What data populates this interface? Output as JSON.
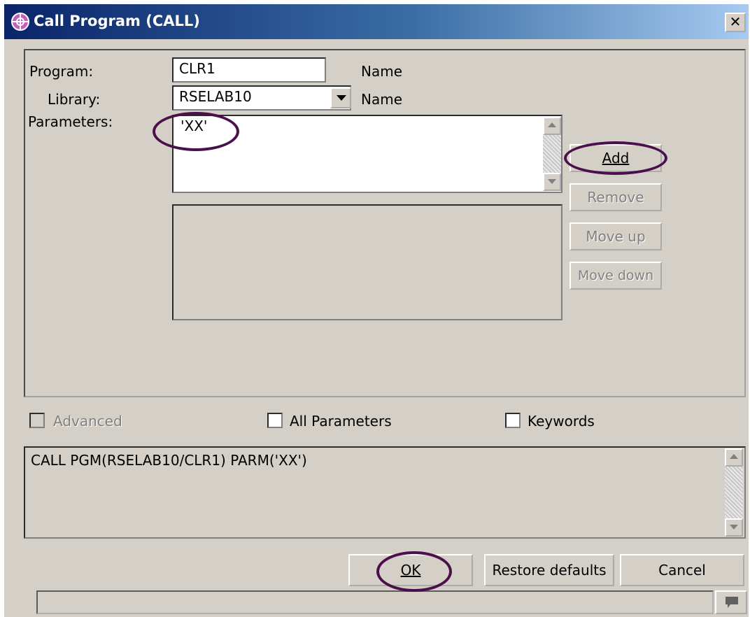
{
  "window": {
    "title": "Call Program (CALL)",
    "close_glyph": "✕"
  },
  "form": {
    "program_label": "Program:",
    "program_value": "CLR1",
    "program_hint": "Name",
    "library_label": "Library:",
    "library_value": "RSELAB10",
    "library_hint": "Name",
    "parameters_label": "Parameters:",
    "parameters_value": "'XX'"
  },
  "buttons": {
    "add": "Add",
    "remove": "Remove",
    "move_up": "Move up",
    "move_down": "Move down",
    "ok": "OK",
    "restore_defaults": "Restore defaults",
    "cancel": "Cancel"
  },
  "options": {
    "advanced": "Advanced",
    "all_parameters": "All Parameters",
    "keywords": "Keywords"
  },
  "command_preview": "CALL PGM(RSELAB10/CLR1) PARM('XX')",
  "icons": {
    "app": "gear-globe-icon",
    "status": "speech-bubble-icon"
  },
  "colors": {
    "annotation": "#4b0f4b",
    "titlebar": "#0a246a"
  }
}
